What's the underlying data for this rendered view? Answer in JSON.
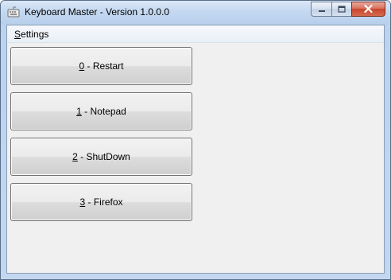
{
  "window": {
    "title": "Keyboard Master - Version 1.0.0.0"
  },
  "menu": {
    "settings_hotkey": "S",
    "settings_rest": "ettings"
  },
  "buttons": [
    {
      "key": "0",
      "label": " - Restart"
    },
    {
      "key": "1",
      "label": " - Notepad"
    },
    {
      "key": "2",
      "label": " - ShutDown"
    },
    {
      "key": "3",
      "label": " - Firefox"
    }
  ],
  "icons": {
    "app": "keyboard-app-icon",
    "minimize": "minimize-icon",
    "maximize": "maximize-icon",
    "close": "close-icon"
  },
  "colors": {
    "title_bar": "#c4d8f0",
    "client_background": "#f0f0f0",
    "close_button": "#c8442d"
  }
}
